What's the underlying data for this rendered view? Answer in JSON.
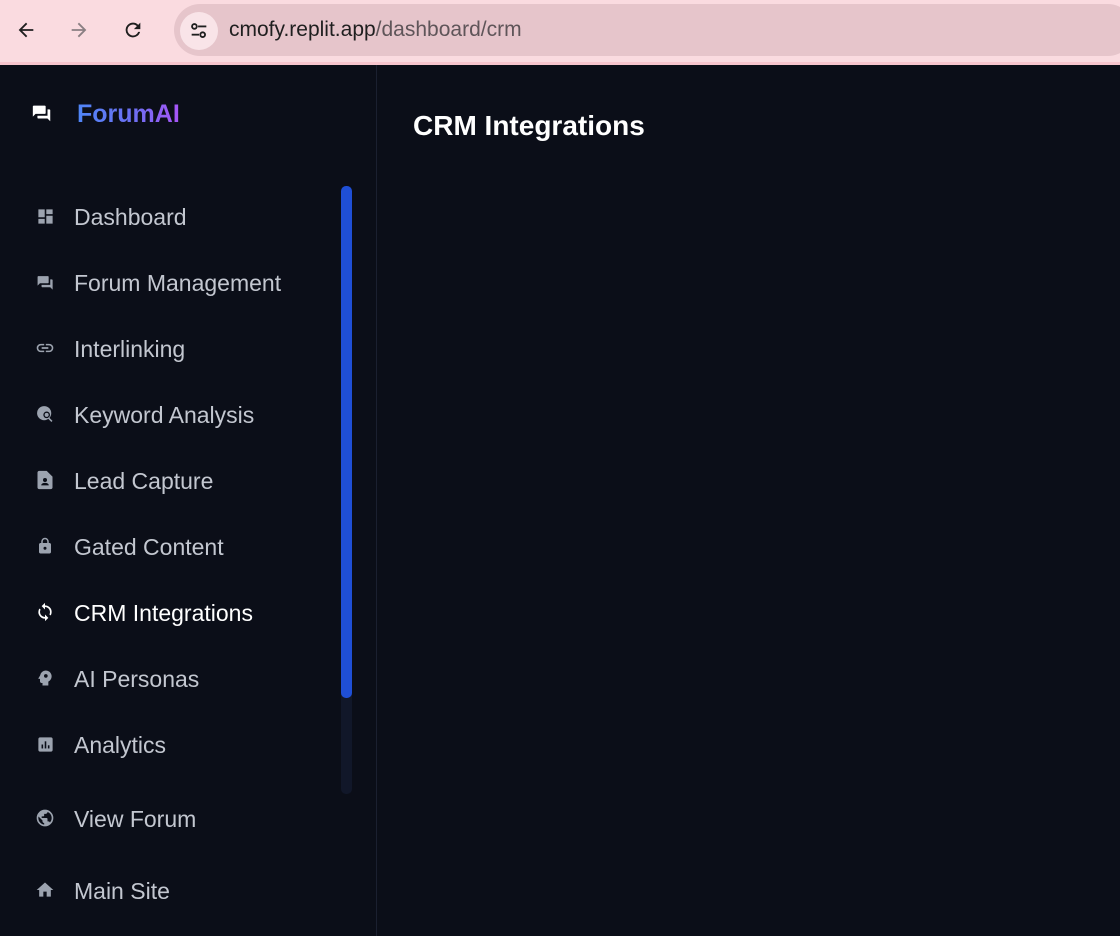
{
  "browser": {
    "url_host": "cmofy.replit.app",
    "url_path": "/dashboard/crm"
  },
  "sidebar": {
    "brand": "ForumAI",
    "items": [
      {
        "label": "Dashboard",
        "icon": "dashboard-icon"
      },
      {
        "label": "Forum Management",
        "icon": "forum-icon"
      },
      {
        "label": "Interlinking",
        "icon": "link-icon"
      },
      {
        "label": "Keyword Analysis",
        "icon": "search-analytics-icon"
      },
      {
        "label": "Lead Capture",
        "icon": "contact-page-icon"
      },
      {
        "label": "Gated Content",
        "icon": "lock-icon"
      },
      {
        "label": "CRM Integrations",
        "icon": "sync-icon",
        "active": true
      },
      {
        "label": "AI Personas",
        "icon": "psychology-icon"
      },
      {
        "label": "Analytics",
        "icon": "analytics-icon"
      }
    ],
    "footer_items": [
      {
        "label": "View Forum",
        "icon": "globe-icon"
      },
      {
        "label": "Main Site",
        "icon": "home-icon"
      }
    ]
  },
  "main": {
    "title": "CRM Integrations"
  },
  "colors": {
    "background": "#0b0e18",
    "accent": "#1f4fd6",
    "chrome": "#fadbe0",
    "brand_gradient_start": "#4f86f7",
    "brand_gradient_end": "#a855f7"
  }
}
